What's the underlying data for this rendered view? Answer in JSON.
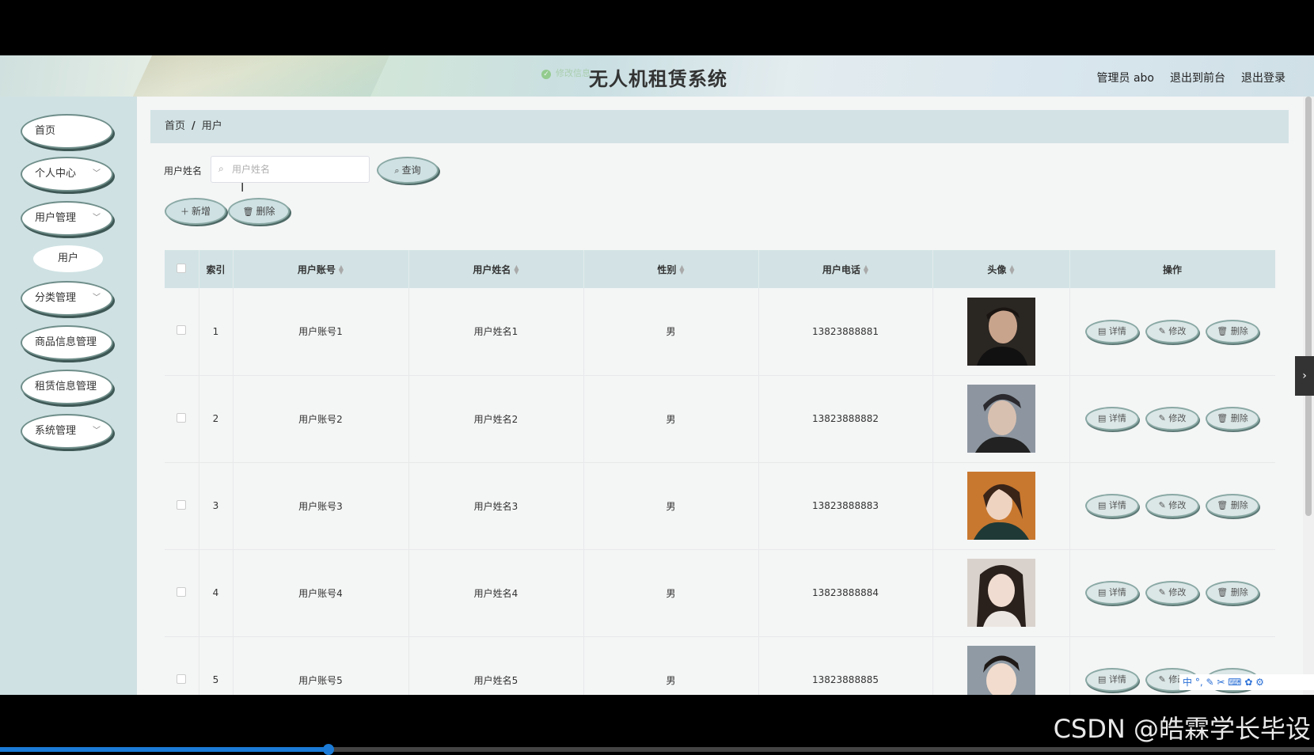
{
  "header": {
    "toast": "修改信息",
    "title": "无人机租赁系统",
    "user": "管理员 abo",
    "to_front": "退出到前台",
    "logout": "退出登录"
  },
  "sidebar": {
    "items": [
      {
        "label": "首页",
        "has_children": false
      },
      {
        "label": "个人中心",
        "has_children": true
      },
      {
        "label": "用户管理",
        "has_children": true
      },
      {
        "label": "分类管理",
        "has_children": true
      },
      {
        "label": "商品信息管理",
        "has_children": false
      },
      {
        "label": "租赁信息管理",
        "has_children": false
      },
      {
        "label": "系统管理",
        "has_children": true
      }
    ],
    "sub_item": "用户"
  },
  "breadcrumb": {
    "home": "首页",
    "sep": "/",
    "current": "用户"
  },
  "search": {
    "label": "用户姓名",
    "placeholder": "用户姓名",
    "query_button": "查询"
  },
  "toolbar": {
    "add": "新增",
    "delete": "删除"
  },
  "table": {
    "columns": [
      "索引",
      "用户账号",
      "用户姓名",
      "性别",
      "用户电话",
      "头像",
      "操作"
    ],
    "rows": [
      {
        "index": "1",
        "account": "用户账号1",
        "name": "用户姓名1",
        "gender": "男",
        "phone": "13823888881",
        "avatar": "avatar-1"
      },
      {
        "index": "2",
        "account": "用户账号2",
        "name": "用户姓名2",
        "gender": "男",
        "phone": "13823888882",
        "avatar": "avatar-2"
      },
      {
        "index": "3",
        "account": "用户账号3",
        "name": "用户姓名3",
        "gender": "男",
        "phone": "13823888883",
        "avatar": "avatar-3"
      },
      {
        "index": "4",
        "account": "用户账号4",
        "name": "用户姓名4",
        "gender": "男",
        "phone": "13823888884",
        "avatar": "avatar-4"
      },
      {
        "index": "5",
        "account": "用户账号5",
        "name": "用户姓名5",
        "gender": "男",
        "phone": "13823888885",
        "avatar": "avatar-5"
      }
    ],
    "actions": {
      "detail": "详情",
      "edit": "修改",
      "delete": "删除"
    }
  },
  "ime": "中 °, ✎ ✂ ⌨ ✿ ⚙",
  "watermark": "CSDN @皓霖学长毕设",
  "video_progress": 0.25
}
